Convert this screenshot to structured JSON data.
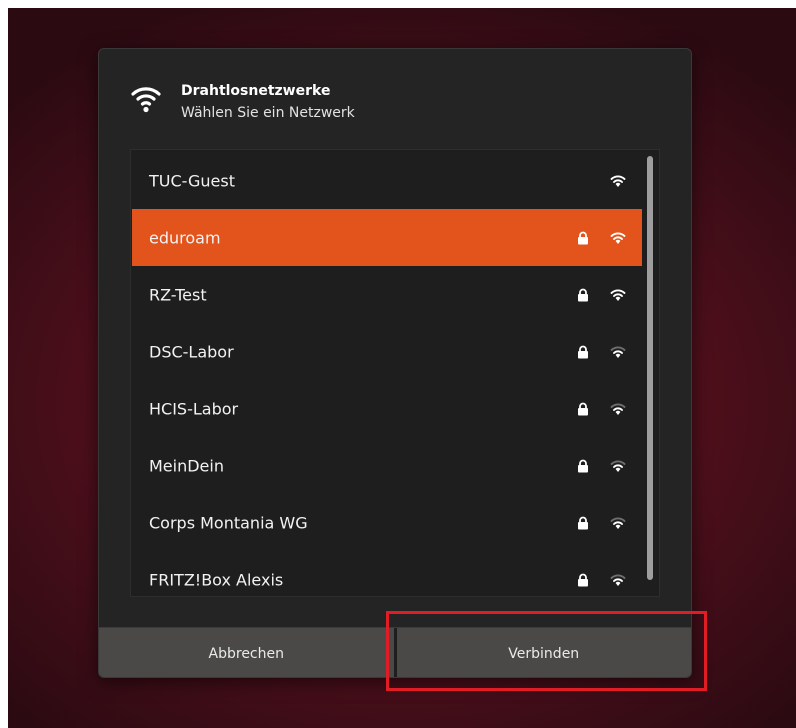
{
  "dialog": {
    "title": "Drahtlosnetzwerke",
    "subtitle": "Wählen Sie ein Netzwerk",
    "icon": "wifi-icon"
  },
  "networks": [
    {
      "label": "TUC-Guest",
      "secured": false,
      "signal": "strong",
      "selected": false
    },
    {
      "label": "eduroam",
      "secured": true,
      "signal": "strong",
      "selected": true
    },
    {
      "label": "RZ-Test",
      "secured": true,
      "signal": "strong",
      "selected": false
    },
    {
      "label": "DSC-Labor",
      "secured": true,
      "signal": "weak",
      "selected": false
    },
    {
      "label": "HCIS-Labor",
      "secured": true,
      "signal": "weak",
      "selected": false
    },
    {
      "label": "MeinDein",
      "secured": true,
      "signal": "weak",
      "selected": false
    },
    {
      "label": "Corps Montania WG",
      "secured": true,
      "signal": "weak",
      "selected": false
    },
    {
      "label": "FRITZ!Box Alexis",
      "secured": true,
      "signal": "weak",
      "selected": false
    }
  ],
  "buttons": {
    "cancel_label": "Abbrechen",
    "connect_label": "Verbinden"
  },
  "colors": {
    "selected_row": "#e2541b",
    "dialog_bg": "#252424",
    "button_bg": "#4a4947",
    "highlight": "#e01c24"
  }
}
